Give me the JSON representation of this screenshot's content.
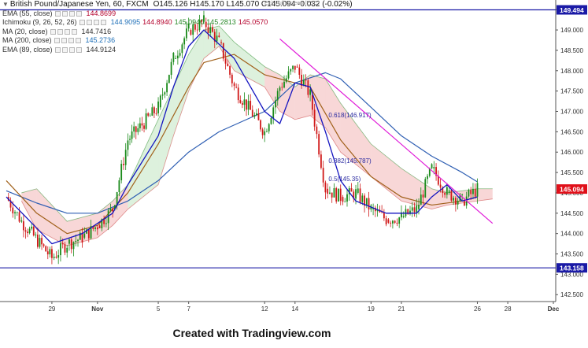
{
  "header": {
    "symbol": "British Pound/Japanese Yen, 60, FXCM",
    "ohlc": "O145.126 H145.170 L145.070 C145.094 -0.032 (-0.02%)",
    "exit_fullscreen": "Exit Full Screen (ESC)"
  },
  "indicators": [
    {
      "name": "EMA (55, close)",
      "values": [
        "144.8699"
      ],
      "colors": [
        "#b4002b"
      ]
    },
    {
      "name": "Ichimoku (9, 26, 52, 26)",
      "values": [
        "144.9095",
        "144.8940",
        "145.0940",
        "145.2813",
        "145.0570"
      ],
      "colors": [
        "#1e6fb8",
        "#b4002b",
        "#2a8a2a",
        "#2a8a2a",
        "#b4002b"
      ]
    },
    {
      "name": "MA (20, close)",
      "values": [
        "144.7416"
      ],
      "colors": [
        "#333333"
      ]
    },
    {
      "name": "MA (200, close)",
      "values": [
        "145.2736"
      ],
      "colors": [
        "#1e6fb8"
      ]
    },
    {
      "name": "EMA (89, close)",
      "values": [
        "144.9124"
      ],
      "colors": [
        "#333333"
      ]
    }
  ],
  "chart_data": {
    "type": "candlestick",
    "y_ticks": [
      "149.500",
      "149.000",
      "148.500",
      "148.000",
      "147.500",
      "147.000",
      "146.500",
      "146.000",
      "145.500",
      "145.000",
      "144.500",
      "144.000",
      "143.500",
      "143.000",
      "142.500"
    ],
    "y_range": [
      142.35,
      149.62
    ],
    "x_ticks": [
      "29",
      "Nov",
      "5",
      "7",
      "12",
      "14",
      "19",
      "21",
      "26",
      "28",
      "Dec"
    ],
    "price_labels": [
      {
        "text": "149.494",
        "value": 149.494,
        "color": "#1a1aa6"
      },
      {
        "text": "145.094",
        "value": 145.094,
        "color": "#e0101a"
      },
      {
        "text": "143.158",
        "value": 143.158,
        "color": "#1a1aa6"
      }
    ],
    "horizontal_lines": [
      149.494,
      143.158
    ],
    "fib_labels": [
      {
        "text": "0.618(146.917)",
        "value": 146.917
      },
      {
        "text": "0.382(145.787)",
        "value": 145.787
      },
      {
        "text": "0.5(145.35)",
        "value": 145.35
      }
    ],
    "trendline": {
      "color": "#e01ad8",
      "from": {
        "date": "Nov 13",
        "price": 148.78
      },
      "to": {
        "date": "Nov 27",
        "price": 144.25
      }
    },
    "series_path": [
      [
        "Oct 26",
        144.9
      ],
      [
        "Oct 27",
        144.3
      ],
      [
        "Oct 29",
        143.4
      ],
      [
        "Oct 30",
        143.75
      ],
      [
        "Oct 31",
        143.9
      ],
      [
        "Nov 1",
        144.2
      ],
      [
        "Nov 2",
        144.6
      ],
      [
        "Nov 3",
        146.3
      ],
      [
        "Nov 5",
        147.1
      ],
      [
        "Nov 6",
        148.3
      ],
      [
        "Nov 7",
        149.0
      ],
      [
        "Nov 8",
        149.2
      ],
      [
        "Nov 9",
        148.7
      ],
      [
        "Nov 10",
        147.6
      ],
      [
        "Nov 12",
        146.5
      ],
      [
        "Nov 13",
        147.6
      ],
      [
        "Nov 14",
        148.1
      ],
      [
        "Nov 15",
        147.4
      ],
      [
        "Nov 16",
        145.1
      ],
      [
        "Nov 17",
        144.9
      ],
      [
        "Nov 18",
        145.0
      ],
      [
        "Nov 19",
        144.6
      ],
      [
        "Nov 20",
        144.35
      ],
      [
        "Nov 21",
        144.4
      ],
      [
        "Nov 22",
        144.6
      ],
      [
        "Nov 23",
        145.6
      ],
      [
        "Nov 24",
        145.0
      ],
      [
        "Nov 25",
        144.8
      ],
      [
        "Nov 26",
        145.09
      ]
    ],
    "ma_blue_path": [
      [
        "Oct 26",
        144.9
      ],
      [
        "Oct 29",
        143.75
      ],
      [
        "Oct 31",
        144.0
      ],
      [
        "Nov 2",
        144.5
      ],
      [
        "Nov 3",
        145.2
      ],
      [
        "Nov 5",
        146.4
      ],
      [
        "Nov 6",
        147.6
      ],
      [
        "Nov 7",
        148.6
      ],
      [
        "Nov 8",
        149.0
      ],
      [
        "Nov 10",
        148.3
      ],
      [
        "Nov 12",
        147.0
      ],
      [
        "Nov 13",
        146.7
      ],
      [
        "Nov 14",
        147.7
      ],
      [
        "Nov 15",
        147.6
      ],
      [
        "Nov 16",
        146.5
      ],
      [
        "Nov 17",
        145.3
      ],
      [
        "Nov 18",
        144.8
      ],
      [
        "Nov 20",
        144.5
      ],
      [
        "Nov 22",
        144.5
      ],
      [
        "Nov 23",
        144.9
      ],
      [
        "Nov 24",
        145.2
      ],
      [
        "Nov 25",
        144.8
      ],
      [
        "Nov 26",
        144.9
      ]
    ],
    "ma200_path": [
      [
        "Oct 26",
        145.05
      ],
      [
        "Oct 28",
        144.75
      ],
      [
        "Oct 30",
        144.5
      ],
      [
        "Nov 1",
        144.5
      ],
      [
        "Nov 3",
        144.8
      ],
      [
        "Nov 5",
        145.3
      ],
      [
        "Nov 7",
        146.0
      ],
      [
        "Nov 9",
        146.5
      ],
      [
        "Nov 12",
        147.0
      ],
      [
        "Nov 14",
        147.7
      ],
      [
        "Nov 16",
        147.95
      ],
      [
        "Nov 17",
        147.8
      ],
      [
        "Nov 19",
        147.1
      ],
      [
        "Nov 21",
        146.4
      ],
      [
        "Nov 23",
        145.9
      ],
      [
        "Nov 25",
        145.5
      ],
      [
        "Nov 26",
        145.27
      ]
    ],
    "ema_brown_path": [
      [
        "Oct 26",
        145.3
      ],
      [
        "Oct 28",
        144.5
      ],
      [
        "Oct 30",
        144.0
      ],
      [
        "Nov 1",
        144.2
      ],
      [
        "Nov 3",
        145.0
      ],
      [
        "Nov 5",
        146.2
      ],
      [
        "Nov 7",
        147.6
      ],
      [
        "Nov 8",
        148.2
      ],
      [
        "Nov 10",
        148.4
      ],
      [
        "Nov 12",
        147.9
      ],
      [
        "Nov 14",
        147.7
      ],
      [
        "Nov 15",
        147.6
      ],
      [
        "Nov 17",
        146.3
      ],
      [
        "Nov 19",
        145.4
      ],
      [
        "Nov 21",
        144.9
      ],
      [
        "Nov 23",
        144.7
      ],
      [
        "Nov 25",
        144.8
      ],
      [
        "Nov 26",
        144.9
      ]
    ],
    "cloud_path": [
      [
        "Oct 27",
        144.8,
        145.0
      ],
      [
        "Oct 28",
        144.1,
        145.1
      ],
      [
        "Oct 30",
        143.7,
        144.3
      ],
      [
        "Nov 1",
        143.9,
        144.5
      ],
      [
        "Nov 2",
        144.2,
        144.8
      ],
      [
        "Nov 3",
        144.6,
        145.2
      ],
      [
        "Nov 5",
        145.2,
        146.8
      ],
      [
        "Nov 6",
        146.4,
        147.6
      ],
      [
        "Nov 7",
        147.5,
        148.4
      ],
      [
        "Nov 8",
        148.3,
        149.0
      ],
      [
        "Nov 9",
        148.6,
        149.1
      ],
      [
        "Nov 10",
        148.0,
        148.7
      ],
      [
        "Nov 12",
        147.6,
        148.1
      ],
      [
        "Nov 13",
        147.0,
        147.9
      ],
      [
        "Nov 14",
        146.8,
        147.6
      ],
      [
        "Nov 15",
        146.9,
        147.9
      ],
      [
        "Nov 16",
        146.6,
        147.8
      ],
      [
        "Nov 17",
        146.0,
        147.2
      ],
      [
        "Nov 19",
        145.4,
        146.2
      ],
      [
        "Nov 21",
        144.8,
        145.6
      ],
      [
        "Nov 23",
        144.6,
        145.1
      ],
      [
        "Nov 24",
        144.7,
        145.0
      ],
      [
        "Nov 26",
        144.8,
        145.1
      ],
      [
        "Nov 27",
        144.85,
        145.1
      ]
    ]
  },
  "footer": {
    "text": "Created with Tradingview.com"
  }
}
